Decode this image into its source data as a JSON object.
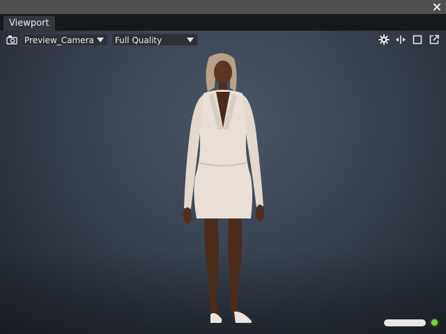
{
  "window": {
    "tab_label": "Viewport"
  },
  "toolbar": {
    "camera_select": "Preview_Camera",
    "quality_select": "Full Quality",
    "icons": [
      "camera-icon",
      "gear-icon",
      "fit-width-icon",
      "maximize-icon",
      "pop-out-icon"
    ]
  },
  "status": {
    "indicator_color": "#6fd13c"
  },
  "colors": {
    "viewport_background": "#3a4453",
    "title_bar": "#505050",
    "tab_strip": "#16181b"
  }
}
